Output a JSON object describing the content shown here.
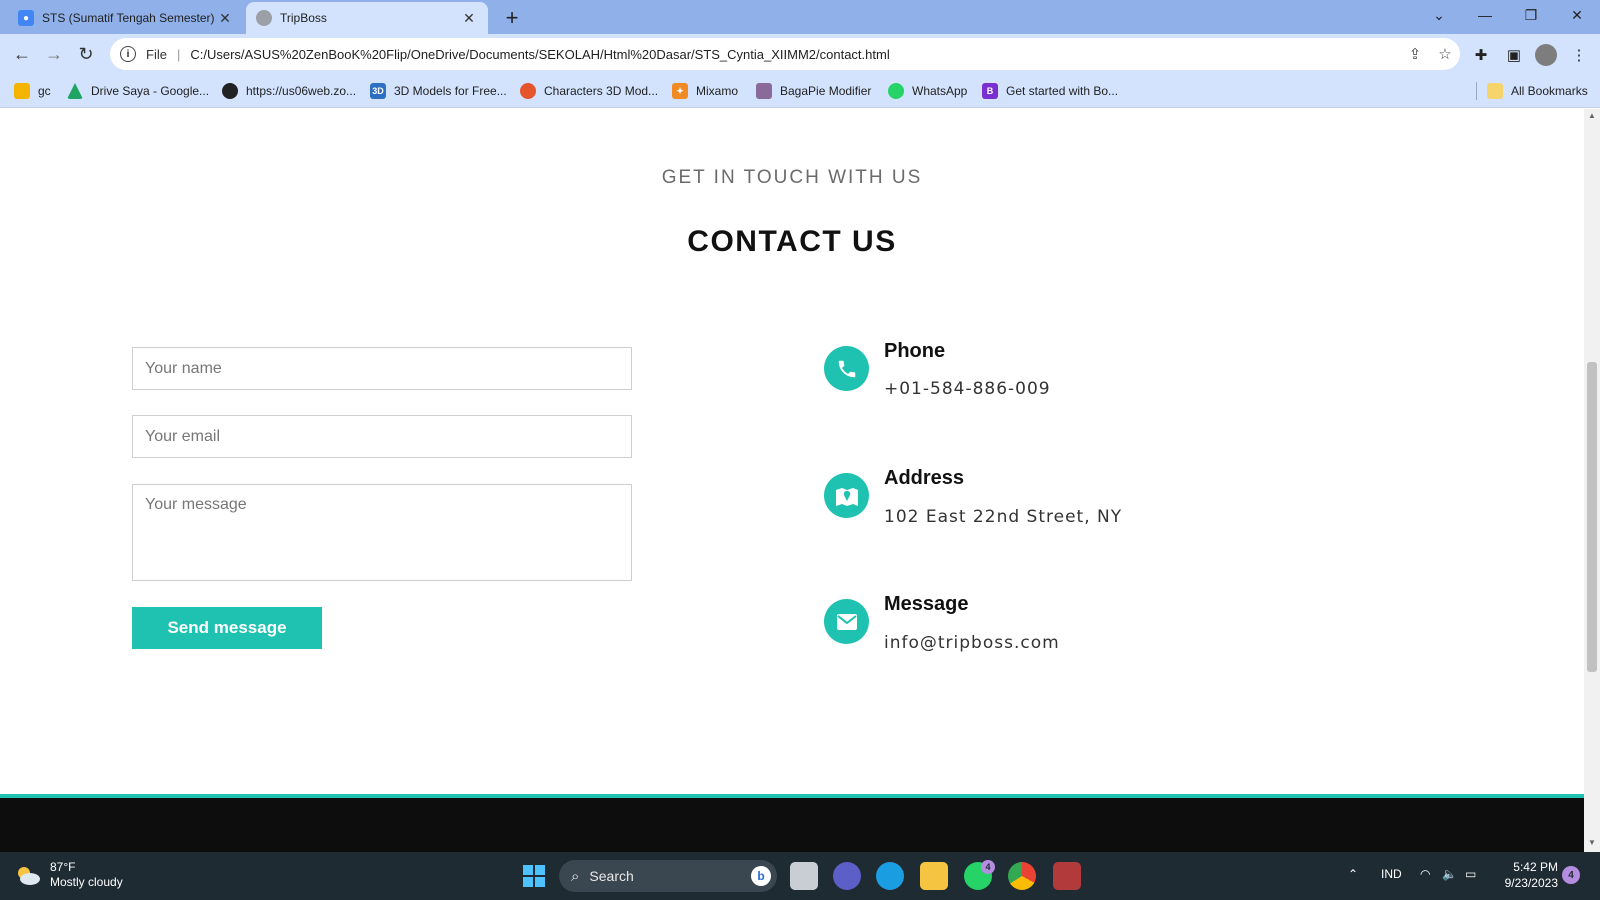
{
  "browser": {
    "tabs": [
      {
        "title": "STS (Sumatif Tengah Semester) C",
        "active": false
      },
      {
        "title": "TripBoss",
        "active": true
      }
    ],
    "address": {
      "scheme": "File",
      "url": "C:/Users/ASUS%20ZenBooK%20Flip/OneDrive/Documents/SEKOLAH/Html%20Dasar/STS_Cyntia_XIIMM2/contact.html"
    },
    "bookmarks": [
      {
        "label": "gc",
        "icon": "classroom-icon",
        "color": "#f4b400"
      },
      {
        "label": "Drive Saya - Google...",
        "icon": "drive-icon",
        "color": "#1fa463"
      },
      {
        "label": "https://us06web.zo...",
        "icon": "globe-icon",
        "color": "#222222"
      },
      {
        "label": "3D Models for Free...",
        "icon": "3d-icon",
        "color": "#2d6fc1"
      },
      {
        "label": "Characters 3D Mod...",
        "icon": "mixamo-icon",
        "color": "#e5542b"
      },
      {
        "label": "Mixamo",
        "icon": "runner-icon",
        "color": "#f08a24"
      },
      {
        "label": "BagaPie Modifier",
        "icon": "bagapie-icon",
        "color": "#8a6a9b"
      },
      {
        "label": "WhatsApp",
        "icon": "whatsapp-icon",
        "color": "#25d366"
      },
      {
        "label": "Get started with Bo...",
        "icon": "bootstrap-icon",
        "color": "#7b2fd1"
      }
    ],
    "all_bookmarks": "All Bookmarks"
  },
  "page": {
    "eyebrow": "GET IN TOUCH WITH US",
    "heading": "CONTACT US",
    "form": {
      "name_placeholder": "Your name",
      "email_placeholder": "Your email",
      "message_placeholder": "Your message",
      "send_label": "Send message"
    },
    "contacts": [
      {
        "title": "Phone",
        "value": "+01-584-886-009",
        "icon": "phone-icon"
      },
      {
        "title": "Address",
        "value": "102 East 22nd Street, NY",
        "icon": "map-icon"
      },
      {
        "title": "Message",
        "value": "info@tripboss.com",
        "icon": "envelope-icon"
      }
    ],
    "accent": "#1fc2b0"
  },
  "taskbar": {
    "weather_temp": "87°F",
    "weather_desc": "Mostly cloudy",
    "search_label": "Search",
    "lang": "IND",
    "time": "5:42 PM",
    "date": "9/23/2023",
    "notifications": "4",
    "whatsapp_badge": "4"
  }
}
